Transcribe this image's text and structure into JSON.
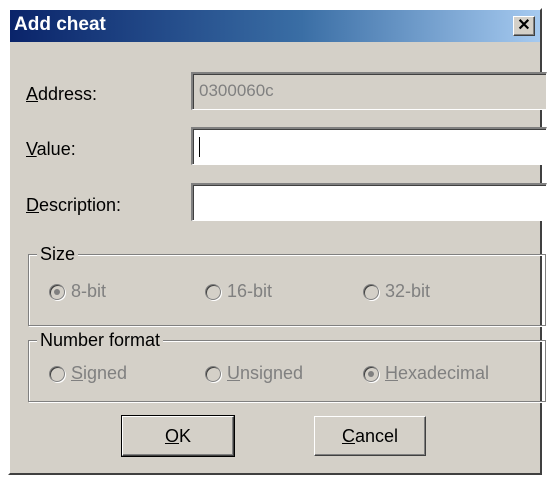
{
  "window": {
    "title": "Add cheat",
    "close_glyph": "✕"
  },
  "fields": {
    "address": {
      "label_access": "A",
      "label_rest": "ddress:",
      "value": "0300060c"
    },
    "value": {
      "label_access": "V",
      "label_rest": "alue:",
      "value": ""
    },
    "description": {
      "label_access": "D",
      "label_rest": "escription:",
      "value": ""
    }
  },
  "size_group": {
    "legend": "Size",
    "options": [
      {
        "label": "8-bit",
        "checked": true
      },
      {
        "label": "16-bit",
        "checked": false
      },
      {
        "label": "32-bit",
        "checked": false
      }
    ]
  },
  "format_group": {
    "legend": "Number format",
    "options": [
      {
        "access": "S",
        "rest": "igned",
        "checked": false
      },
      {
        "access": "U",
        "rest": "nsigned",
        "checked": false
      },
      {
        "access": "H",
        "rest": "exadecimal",
        "checked": true
      }
    ]
  },
  "buttons": {
    "ok": {
      "access": "O",
      "rest": "K"
    },
    "cancel": {
      "access": "C",
      "rest": "ancel"
    }
  }
}
